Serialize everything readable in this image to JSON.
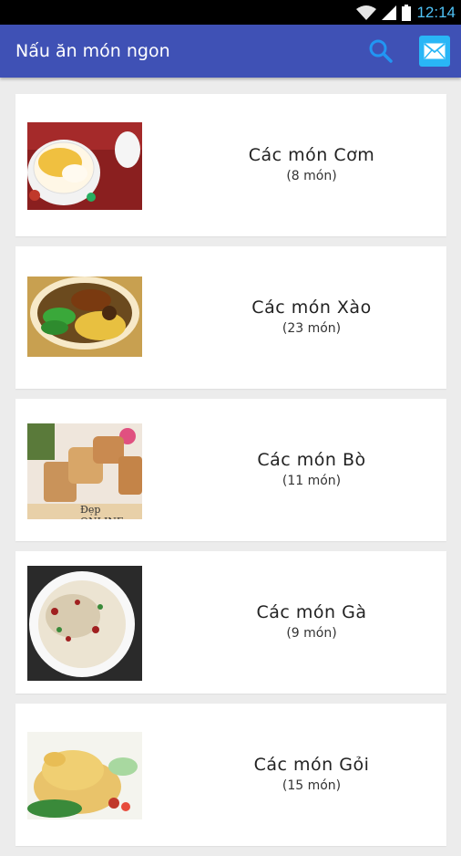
{
  "status": {
    "time": "12:14"
  },
  "appbar": {
    "title": "Nấu ăn món ngon"
  },
  "categories": [
    {
      "name": "Các món Cơm",
      "count": "(8 món)",
      "image": "rice-dessert-bowl"
    },
    {
      "name": "Các món Xào",
      "count": "(23 món)",
      "image": "noodle-soup-bowl"
    },
    {
      "name": "Các món Bò",
      "count": "(11 món)",
      "image": "beef-rolls"
    },
    {
      "name": "Các món Gà",
      "count": "(9 món)",
      "image": "chicken-rice-plate"
    },
    {
      "name": "Các món Gỏi",
      "count": "(15 món)",
      "image": "boiled-chicken"
    }
  ],
  "thumb_watermark": "Đẹp ONLINE",
  "colors": {
    "appbar": "#3f51b5",
    "mail_button": "#29b6f6",
    "search_icon": "#2196f3",
    "background": "#ececec"
  },
  "icons": {
    "search": "search-icon",
    "mail": "mail-icon",
    "wifi": "wifi-icon",
    "signal": "signal-icon",
    "battery": "battery-icon"
  }
}
